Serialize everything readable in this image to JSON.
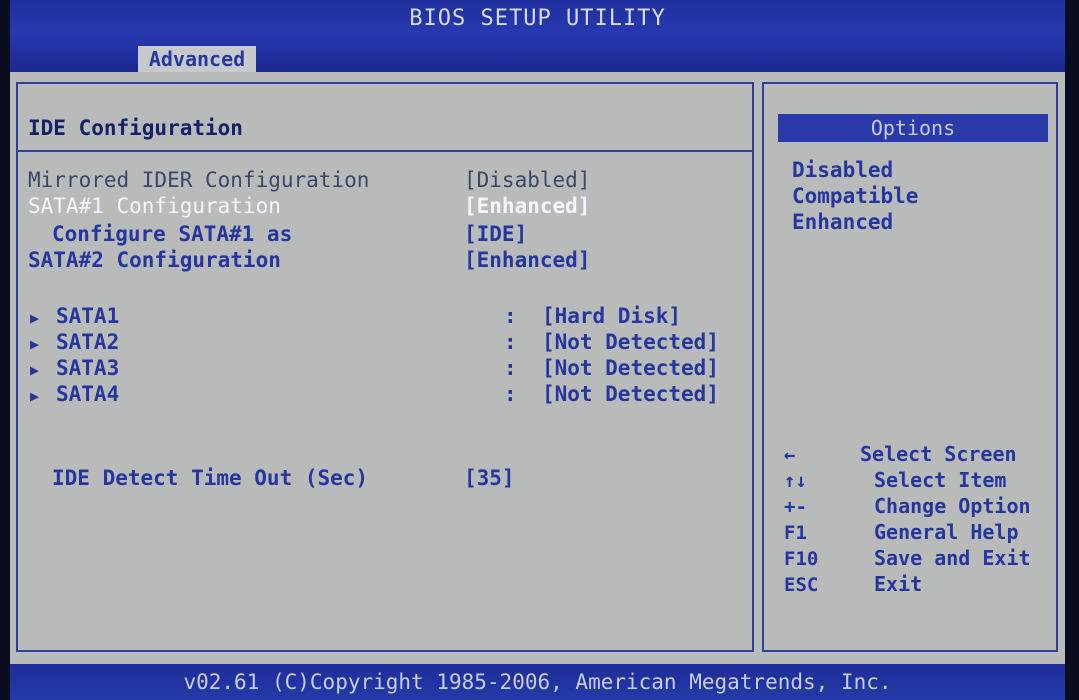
{
  "header": {
    "title": "BIOS SETUP UTILITY",
    "active_tab": "Advanced"
  },
  "main": {
    "section_title": "IDE Configuration",
    "settings": [
      {
        "label": "Mirrored IDER Configuration",
        "value": "[Disabled]"
      },
      {
        "label": "SATA#1 Configuration",
        "value": "[Enhanced]"
      },
      {
        "label": "Configure SATA#1 as",
        "value": "[IDE]"
      },
      {
        "label": "SATA#2 Configuration",
        "value": "[Enhanced]"
      }
    ],
    "sata_ports": [
      {
        "label": "SATA1",
        "value": "[Hard Disk]"
      },
      {
        "label": "SATA2",
        "value": "[Not Detected]"
      },
      {
        "label": "SATA3",
        "value": "[Not Detected]"
      },
      {
        "label": "SATA4",
        "value": "[Not Detected]"
      }
    ],
    "separator": ":",
    "timeout": {
      "label": "IDE Detect Time Out (Sec)",
      "value": "[35]"
    }
  },
  "options_panel": {
    "heading": "Options",
    "options": [
      "Disabled",
      "Compatible",
      "Enhanced"
    ],
    "help": [
      {
        "key": "←",
        "desc": "Select Screen"
      },
      {
        "key": "↑↓",
        "desc": "Select Item"
      },
      {
        "key": "+-",
        "desc": "Change Option"
      },
      {
        "key": "F1",
        "desc": "General Help"
      },
      {
        "key": "F10",
        "desc": "Save and Exit"
      },
      {
        "key": "ESC",
        "desc": "Exit"
      }
    ]
  },
  "footer": {
    "copyright": "v02.61 (C)Copyright 1985-2006, American Megatrends, Inc."
  }
}
